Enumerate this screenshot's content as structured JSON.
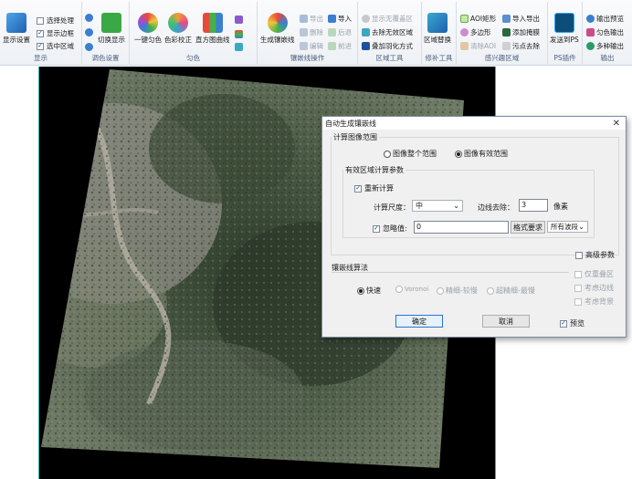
{
  "ribbon": {
    "groups": {
      "display": "显示",
      "color_settings": "调色设置",
      "uniform_color": "匀色",
      "seamline_ops": "镶嵌线操作",
      "region_tools": "区域工具",
      "patch_tools": "修补工具",
      "ps_region": "感兴趣区域",
      "ps_plugin": "PS插件",
      "output": "输出"
    },
    "display_settings": "显示设置",
    "select_process": "选择处理",
    "show_border": "显示边框",
    "selected_region": "选中区域",
    "switch_display": "切换显示",
    "one_key_uniform": "一键匀色",
    "color_correct": "色彩校正",
    "hist_curve": "直方图曲线",
    "gen_seamline": "生成镶嵌线",
    "export": "导出",
    "import": "导入",
    "delete": "删除",
    "undo": "后退",
    "edit": "编辑",
    "redo": "前进",
    "show_no_overlap": "显示无覆盖区",
    "remove_invalid": "去除无效区域",
    "overlay_feather": "叠加羽化方式",
    "region_replace": "区域替换",
    "aoi_rect": "AOI矩形",
    "import_export": "导入导出",
    "polygon": "多边形",
    "add_mask": "添加掩膜",
    "clear_aoi": "清除AOI",
    "remove_dirty": "污点去除",
    "send_ps": "发送到PS",
    "output_preview": "输出预览",
    "color_output": "匀色输出",
    "multi_output": "多种输出"
  },
  "dialog": {
    "title": "自动生成镶嵌线",
    "close": "✕",
    "calc_range_legend": "计算图像范围",
    "range_whole": "图像整个范围",
    "range_valid": "图像有效范围",
    "valid_legend": "有效区域计算参数",
    "recalculate": "重新计算",
    "scale_label": "计算尺度：",
    "scale_value": "中",
    "edge_label": "边线去除：",
    "edge_value": "3",
    "edge_unit": "像素",
    "ignore_label": "忽略值:",
    "ignore_value": "0",
    "format_req": "格式要求",
    "band_select": "所有波段",
    "advanced": "高级参数",
    "algo_legend": "镶嵌线算法",
    "algo_fast": "快速",
    "algo_voronoi": "Voronoi",
    "algo_fine_slow": "精细-较慢",
    "algo_ultra_slow": "超精细-最慢",
    "only_overlap": "仅重叠区",
    "consider_edge": "考虑边线",
    "consider_bg": "考虑背景",
    "ok": "确定",
    "cancel": "取消",
    "preview": "预览"
  },
  "colors": {
    "accent": "#2a74d2",
    "ribbon_bg": "#eef1f5",
    "group_label": "#4a5f80",
    "canvas_border": "#2bb7b7"
  }
}
